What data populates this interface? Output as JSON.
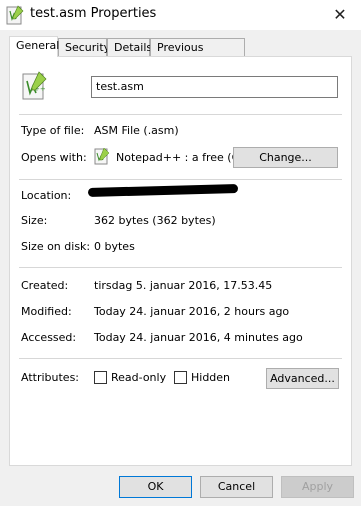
{
  "window": {
    "title": "test.asm Properties"
  },
  "tabs": [
    {
      "label": "General",
      "active": true
    },
    {
      "label": "Security"
    },
    {
      "label": "Details"
    },
    {
      "label": "Previous Versions"
    }
  ],
  "file": {
    "name": "test.asm"
  },
  "type": {
    "label": "Type of file:",
    "value": "ASM File (.asm)"
  },
  "opens": {
    "label": "Opens with:",
    "value": "Notepad++ : a free (GN",
    "change_button": "Change..."
  },
  "location": {
    "label": "Location:"
  },
  "size": {
    "label": "Size:",
    "value": "362 bytes (362 bytes)"
  },
  "size_on_disk": {
    "label": "Size on disk:",
    "value": "0 bytes"
  },
  "created": {
    "label": "Created:",
    "value": "tirsdag 5. januar 2016, 17.53.45"
  },
  "modified": {
    "label": "Modified:",
    "value": "Today 24. januar 2016, 2 hours ago"
  },
  "accessed": {
    "label": "Accessed:",
    "value": "Today 24. januar 2016, 4 minutes ago"
  },
  "attributes": {
    "label": "Attributes:",
    "readonly_label": "Read-only",
    "readonly_checked": false,
    "hidden_label": "Hidden",
    "hidden_checked": false,
    "advanced_button": "Advanced..."
  },
  "buttons": {
    "ok": "OK",
    "cancel": "Cancel",
    "apply": "Apply"
  }
}
